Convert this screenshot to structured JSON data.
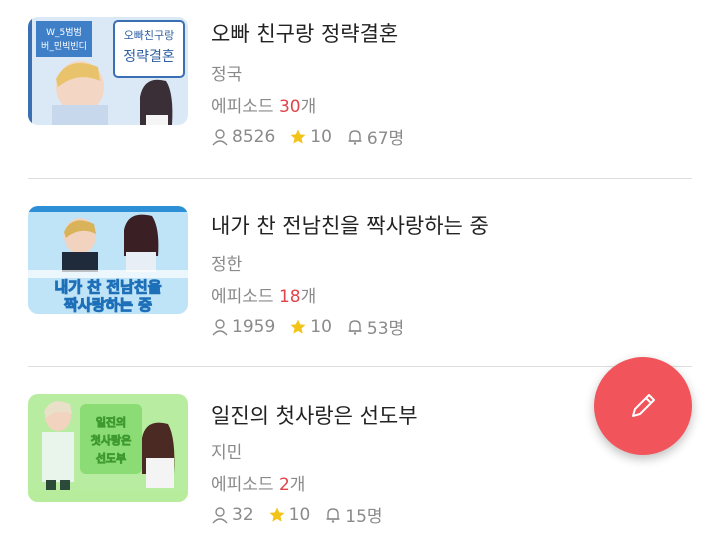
{
  "stories": [
    {
      "title": "오빠 친구랑 정략결혼",
      "author": "정국",
      "episodes_label": "에피소드 ",
      "episodes_count": "30",
      "episodes_suffix": "개",
      "views": "8526",
      "rating": "10",
      "subscribers": "67명",
      "thumb_texts": [
        "오빠친구랑",
        "정략결혼",
        "W_5범범",
        "버_민빅빈디"
      ]
    },
    {
      "title": "내가 찬 전남친을 짝사랑하는 중",
      "author": "정한",
      "episodes_label": "에피소드 ",
      "episodes_count": "18",
      "episodes_suffix": "개",
      "views": "1959",
      "rating": "10",
      "subscribers": "53명",
      "thumb_texts": [
        "내가 찬 전남친을",
        "짝사랑하는 중"
      ]
    },
    {
      "title": "일진의 첫사랑은 선도부",
      "author": "지민",
      "episodes_label": "에피소드 ",
      "episodes_count": "2",
      "episodes_suffix": "개",
      "views": "32",
      "rating": "10",
      "subscribers": "15명",
      "thumb_texts": [
        "일진의",
        "첫사랑은",
        "선도부"
      ]
    }
  ],
  "icons": {
    "views": "person-icon",
    "rating": "star-icon",
    "subscribers": "bell-icon",
    "fab": "pencil-icon"
  },
  "colors": {
    "episode_count": "#e0444b",
    "star": "#f2c418",
    "fab": "#f1555b"
  }
}
